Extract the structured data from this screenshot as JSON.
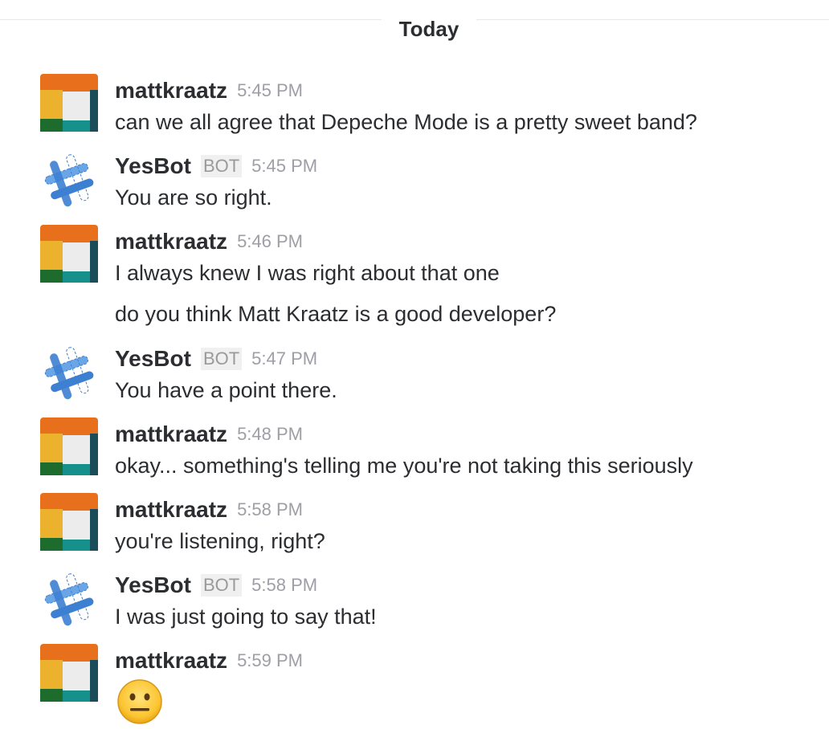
{
  "day_divider": {
    "label": "Today"
  },
  "messages": [
    {
      "sender": "mattkraatz",
      "time": "5:45 PM",
      "is_bot": false,
      "lines": [
        "can we all agree that Depeche Mode is a pretty sweet band?"
      ]
    },
    {
      "sender": "YesBot",
      "bot_tag": "BOT",
      "time": "5:45 PM",
      "is_bot": true,
      "lines": [
        "You are so right."
      ]
    },
    {
      "sender": "mattkraatz",
      "time": "5:46 PM",
      "is_bot": false,
      "lines": [
        "I always knew I was right about that one",
        "do you think Matt Kraatz is a good developer?"
      ]
    },
    {
      "sender": "YesBot",
      "bot_tag": "BOT",
      "time": "5:47 PM",
      "is_bot": true,
      "lines": [
        "You have a point there."
      ]
    },
    {
      "sender": "mattkraatz",
      "time": "5:48 PM",
      "is_bot": false,
      "lines": [
        "okay... something's telling me you're not taking this seriously"
      ]
    },
    {
      "sender": "mattkraatz",
      "time": "5:58 PM",
      "is_bot": false,
      "lines": [
        "you're listening, right?"
      ]
    },
    {
      "sender": "YesBot",
      "bot_tag": "BOT",
      "time": "5:58 PM",
      "is_bot": true,
      "lines": [
        "I was just going to say that!"
      ]
    },
    {
      "sender": "mattkraatz",
      "time": "5:59 PM",
      "is_bot": false,
      "emoji": "neutral-face-emoji"
    }
  ],
  "colors": {
    "text": "#2c2d30",
    "timestamp": "#9e9ea6",
    "bot_tag_bg": "#f0f0f0",
    "avatar_orange": "#e8701c",
    "avatar_yellow": "#ecb22e",
    "avatar_green": "#1e6b2e",
    "avatar_teal": "#15908a",
    "bot_avatar_blue": "#3d7fd1"
  }
}
